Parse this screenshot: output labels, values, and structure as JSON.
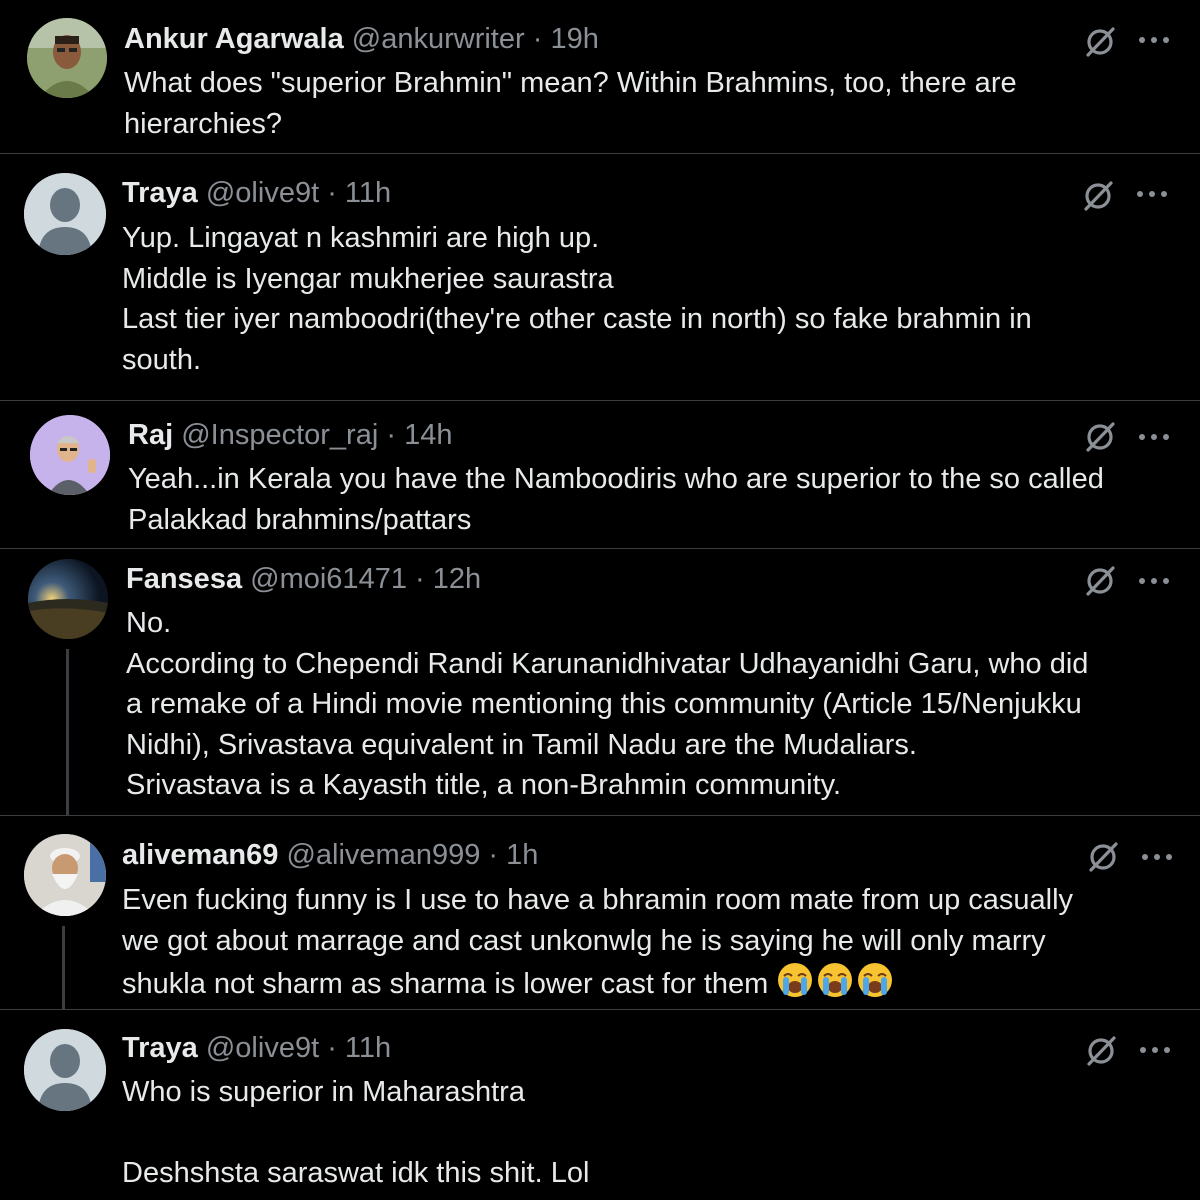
{
  "tweets": [
    {
      "name": "Ankur Agarwala",
      "handle": "@ankurwriter",
      "time": "19h",
      "text": "What does \"superior Brahmin\" mean? Within Brahmins, too, there are\nhierarchies?"
    },
    {
      "name": "Traya",
      "handle": "@olive9t",
      "time": "11h",
      "text": "Yup. Lingayat n kashmiri are high up.\nMiddle is Iyengar mukherjee saurastra\nLast tier iyer namboodri(they're other caste in north) so fake brahmin in\nsouth."
    },
    {
      "name": "Raj",
      "handle": "@Inspector_raj",
      "time": "14h",
      "text": "Yeah...in Kerala you have the Namboodiris who are superior to the so called\nPalakkad brahmins/pattars"
    },
    {
      "name": "Fansesa",
      "handle": "@moi61471",
      "time": "12h",
      "text": "No.\nAccording to Chependi Randi Karunanidhivatar Udhayanidhi Garu, who did\na remake of a Hindi movie mentioning this community (Article 15/Nenjukku\nNidhi), Srivastava equivalent in Tamil Nadu are the Mudaliars.\nSrivastava is a Kayasth title, a non-Brahmin community."
    },
    {
      "name": "aliveman69",
      "handle": "@aliveman999",
      "time": "1h",
      "text": "Even fucking funny is I use to have a bhramin room mate from up casually\nwe got about marrage and cast unkonwlg he is saying he will only marry\nshukla not sharm as sharma is lower cast for them ",
      "emojis": [
        "loudly-crying-face",
        "loudly-crying-face",
        "loudly-crying-face"
      ]
    },
    {
      "name": "Traya",
      "handle": "@olive9t",
      "time": "11h",
      "text": "Who is superior in Maharashtra\n\nDeshshsta saraswat idk this shit. Lol"
    }
  ],
  "separator": " · ",
  "colors": {
    "background": "#000000",
    "text": "#e7e9ea",
    "muted": "#8b9096",
    "divider": "#3a3d41"
  }
}
